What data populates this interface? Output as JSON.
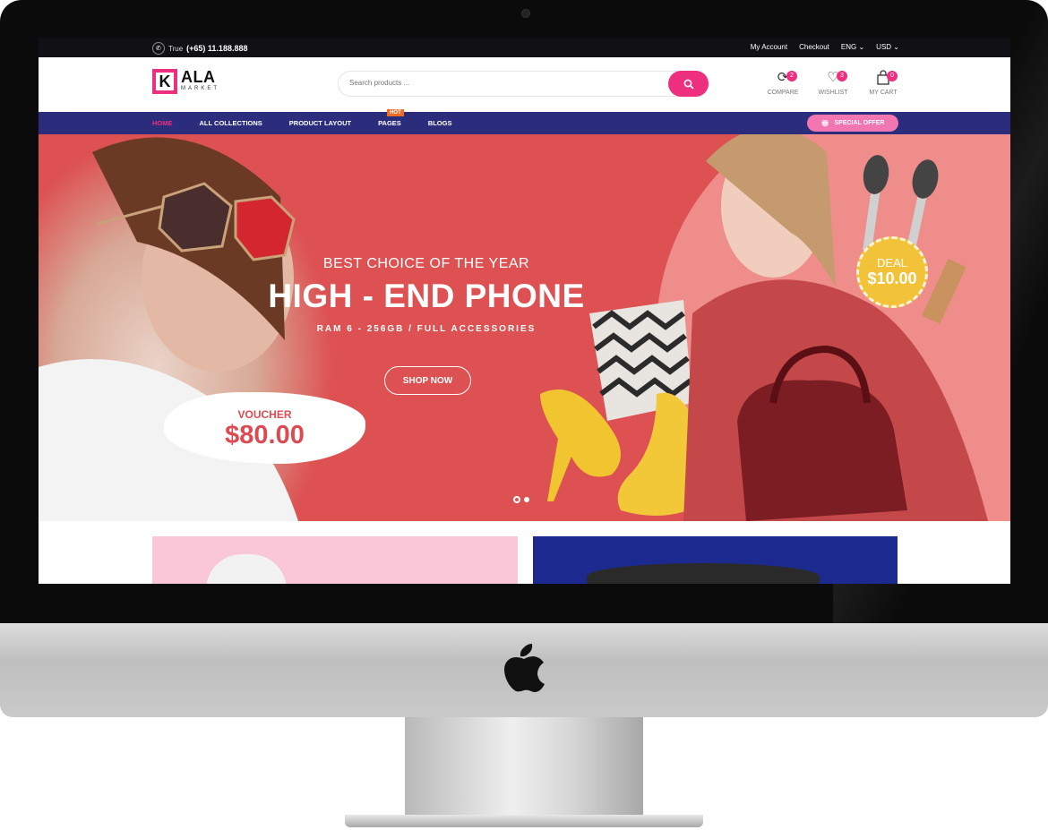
{
  "topbar": {
    "phone_prefix": "True",
    "phone_number": "(+65) 11.188.888",
    "links": [
      "My Account",
      "Checkout",
      "ENG ⌄",
      "USD ⌄"
    ]
  },
  "header": {
    "logo_letter": "K",
    "logo_main": "ALA",
    "logo_sub": "MARKET",
    "search_placeholder": "Search products ...",
    "compare": {
      "label": "COMPARE",
      "count": "2"
    },
    "wishlist": {
      "label": "WISHLIST",
      "count": "3"
    },
    "cart": {
      "label": "MY CART",
      "count": "0"
    }
  },
  "nav": {
    "items": [
      "HOME",
      "ALL COLLECTIONS",
      "PRODUCT LAYOUT",
      "PAGES",
      "BLOGS"
    ],
    "hot_label": "HOT",
    "special_offer": "SPECIAL OFFER"
  },
  "hero": {
    "kicker": "BEST CHOICE OF THE YEAR",
    "title": "HIGH - END PHONE",
    "subtitle": "RAM 6 - 256GB / FULL ACCESSORIES",
    "cta": "SHOP NOW",
    "voucher_label": "VOUCHER",
    "voucher_amount": "$80.00",
    "deal_label": "DEAL",
    "deal_amount": "$10.00"
  },
  "colors": {
    "accent": "#ee2f7f",
    "nav_bg": "#2b2d7c",
    "hero_bg": "#dd5152",
    "deal_bg": "#f2c239"
  }
}
